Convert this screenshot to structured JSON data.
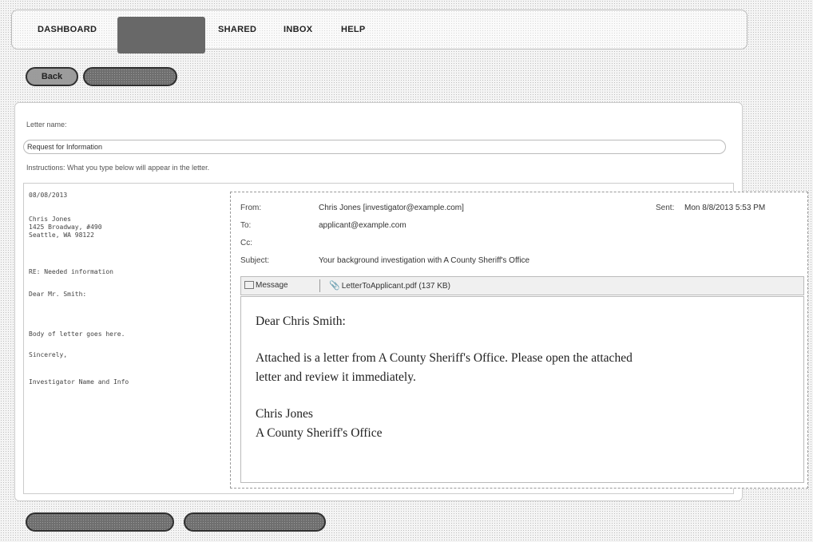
{
  "nav": {
    "items": [
      "DASHBOARD",
      "SHARED",
      "INBOX",
      "HELP"
    ]
  },
  "actions": {
    "back_label": "Back"
  },
  "letter_form": {
    "name_label": "Letter name:",
    "name_value": "Request for Information",
    "instructions": "Instructions: What you type below will appear in the letter.",
    "lines": [
      "08/08/2013",
      "Chris Jones",
      "1425 Broadway, #490",
      "Seattle, WA 98122",
      "RE:  Needed information",
      "Dear Mr. Smith:",
      "Body of letter goes here.",
      "Sincerely,",
      "Investigator Name and Info"
    ]
  },
  "email": {
    "from_label": "From:",
    "from_value": "Chris Jones [investigator@example.com]",
    "sent_label": "Sent:",
    "sent_value": "Mon 8/8/2013 5:53 PM",
    "to_label": "To:",
    "to_value": "applicant@example.com",
    "cc_label": "Cc:",
    "subject_label": "Subject:",
    "subject_value": "Your background investigation with A County Sheriff's Office",
    "tabs": {
      "message": "Message",
      "attachment": "LetterToApplicant.pdf (137 KB)"
    },
    "body": {
      "greeting": "Dear Chris Smith:",
      "para1_line1": "Attached is a letter from A County Sheriff's Office. Please open the attached",
      "para1_line2": "letter and review it immediately.",
      "sig_name": "Chris Jones",
      "sig_org": "A County Sheriff's Office"
    }
  }
}
